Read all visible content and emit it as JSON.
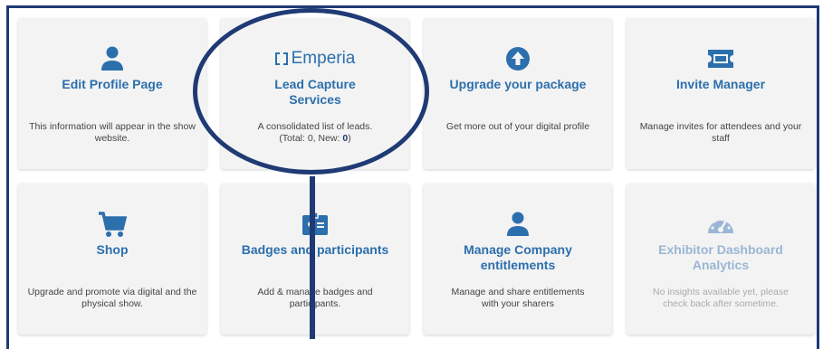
{
  "cards": [
    {
      "title": "Edit Profile Page",
      "desc": "This information will appear in the show website.",
      "icon": "person-icon"
    },
    {
      "logo_text": "Emperia",
      "title": "Lead Capture Services",
      "desc_prefix": "A consolidated list of leads. (Total: 0, New: ",
      "desc_new": "0",
      "desc_suffix": ")",
      "icon": "emperia-logo"
    },
    {
      "title": "Upgrade your package",
      "desc": "Get more out of your digital profile",
      "icon": "arrow-up-circle-icon"
    },
    {
      "title": "Invite Manager",
      "desc": "Manage invites for attendees and your staff",
      "icon": "ticket-icon"
    },
    {
      "title": "Shop",
      "desc": "Upgrade and promote via digital and the physical show.",
      "icon": "cart-icon"
    },
    {
      "title": "Badges and participants",
      "desc": "Add & manage badges and participants.",
      "icon": "badge-icon"
    },
    {
      "title": "Manage Company entitlements",
      "desc": "Manage and share entitlements with your sharers",
      "icon": "person-icon"
    },
    {
      "title": "Exhibitor Dashboard Analytics",
      "desc": "No insights available yet, please check back after sometime.",
      "icon": "gauge-icon",
      "disabled": true
    }
  ],
  "colors": {
    "accent": "#2c6fad",
    "annotation": "#1f3a74",
    "card_bg": "#f3f3f3"
  }
}
